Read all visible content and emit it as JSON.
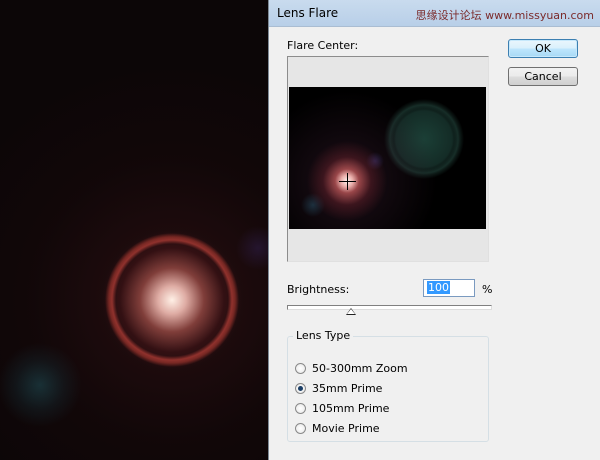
{
  "dialog": {
    "title": "Lens Flare",
    "watermark": "思缘设计论坛 www.missyuan.com"
  },
  "flare_center": {
    "label": "Flare Center:"
  },
  "buttons": {
    "ok": "OK",
    "cancel": "Cancel"
  },
  "brightness": {
    "label": "Brightness:",
    "value": "100",
    "unit": "%"
  },
  "lens_type": {
    "title": "Lens Type",
    "options": [
      {
        "label": "50-300mm Zoom",
        "checked": false
      },
      {
        "label": "35mm Prime",
        "checked": true
      },
      {
        "label": "105mm Prime",
        "checked": false
      },
      {
        "label": "Movie Prime",
        "checked": false
      }
    ]
  }
}
